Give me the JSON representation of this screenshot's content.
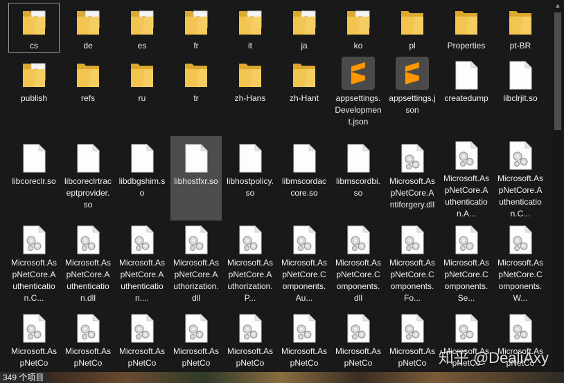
{
  "explorer": {
    "items": [
      {
        "label": "cs",
        "type": "folder-doc",
        "selected": true
      },
      {
        "label": "de",
        "type": "folder-doc"
      },
      {
        "label": "es",
        "type": "folder-doc"
      },
      {
        "label": "fr",
        "type": "folder-doc"
      },
      {
        "label": "it",
        "type": "folder-doc"
      },
      {
        "label": "ja",
        "type": "folder-doc"
      },
      {
        "label": "ko",
        "type": "folder-doc"
      },
      {
        "label": "pl",
        "type": "folder"
      },
      {
        "label": "Properties",
        "type": "folder"
      },
      {
        "label": "pt-BR",
        "type": "folder"
      },
      {
        "label": "publish",
        "type": "folder-doc"
      },
      {
        "label": "refs",
        "type": "folder"
      },
      {
        "label": "ru",
        "type": "folder"
      },
      {
        "label": "tr",
        "type": "folder"
      },
      {
        "label": "zh-Hans",
        "type": "folder"
      },
      {
        "label": "zh-Hant",
        "type": "folder"
      },
      {
        "label": "appsettings.Development.json",
        "type": "sublime"
      },
      {
        "label": "appsettings.json",
        "type": "sublime"
      },
      {
        "label": "createdump",
        "type": "file"
      },
      {
        "label": "libclrjit.so",
        "type": "file"
      },
      {
        "label": "libcoreclr.so",
        "type": "file"
      },
      {
        "label": "libcoreclrtraceptprovider.so",
        "type": "file"
      },
      {
        "label": "libdbgshim.so",
        "type": "file"
      },
      {
        "label": "libhostfxr.so",
        "type": "file",
        "hover": true
      },
      {
        "label": "libhostpolicy.so",
        "type": "file"
      },
      {
        "label": "libmscordaccore.so",
        "type": "file"
      },
      {
        "label": "libmscordbi.so",
        "type": "file"
      },
      {
        "label": "Microsoft.AspNetCore.Antiforgery.dll",
        "type": "dll"
      },
      {
        "label": "Microsoft.AspNetCore.Authentication.A...",
        "type": "dll"
      },
      {
        "label": "Microsoft.AspNetCore.Authentication.C...",
        "type": "dll"
      },
      {
        "label": "Microsoft.AspNetCore.Authentication.C...",
        "type": "dll"
      },
      {
        "label": "Microsoft.AspNetCore.Authentication.dll",
        "type": "dll"
      },
      {
        "label": "Microsoft.AspNetCore.Authentication....",
        "type": "dll"
      },
      {
        "label": "Microsoft.AspNetCore.Authorization.dll",
        "type": "dll"
      },
      {
        "label": "Microsoft.AspNetCore.Authorization.P...",
        "type": "dll"
      },
      {
        "label": "Microsoft.AspNetCore.Components.Au...",
        "type": "dll"
      },
      {
        "label": "Microsoft.AspNetCore.Components.dll",
        "type": "dll"
      },
      {
        "label": "Microsoft.AspNetCore.Components.Fo...",
        "type": "dll"
      },
      {
        "label": "Microsoft.AspNetCore.Components.Se...",
        "type": "dll"
      },
      {
        "label": "Microsoft.AspNetCore.Components.W...",
        "type": "dll"
      },
      {
        "label": "Microsoft.AspNetCo",
        "type": "dll"
      },
      {
        "label": "Microsoft.AspNetCo",
        "type": "dll"
      },
      {
        "label": "Microsoft.AspNetCo",
        "type": "dll"
      },
      {
        "label": "Microsoft.AspNetCo",
        "type": "dll"
      },
      {
        "label": "Microsoft.AspNetCo",
        "type": "dll"
      },
      {
        "label": "Microsoft.AspNetCo",
        "type": "dll"
      },
      {
        "label": "Microsoft.AspNetCo",
        "type": "dll"
      },
      {
        "label": "Microsoft.AspNetCo",
        "type": "dll"
      },
      {
        "label": "Microsoft.AspNetCo",
        "type": "dll"
      },
      {
        "label": "Microsoft.AspNetCo",
        "type": "dll"
      }
    ]
  },
  "status": {
    "item_count": "349 个项目"
  },
  "watermark": "知乎 @DealiAxy",
  "colors": {
    "folder": "#f3c552",
    "folder_dark": "#dca92e",
    "sublime_bg": "#4a4a4a",
    "sublime_s": "#ff9800",
    "selected_border": "#9a9a9a",
    "hover_bg": "#4d4d4d"
  }
}
